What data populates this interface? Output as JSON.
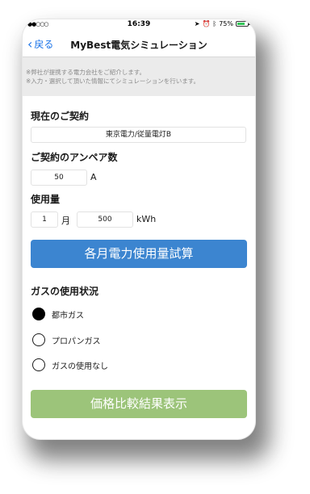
{
  "status_bar": {
    "time": "16:39",
    "signal": "●●○○○",
    "battery_percent": "75%",
    "battery_level": 0.75
  },
  "nav": {
    "back_label": "戻る",
    "title": "MyBest電気シミュレーション"
  },
  "notice": {
    "line1": "※弊社が提携する電力会社をご紹介します。",
    "line2": "※入力・選択して頂いた情報にてシミュレーションを行います。"
  },
  "contract": {
    "heading": "現在のご契約",
    "value": "東京電力/従量電灯B"
  },
  "ampere": {
    "heading": "ご契約のアンペア数",
    "value": "50",
    "unit": "A"
  },
  "usage": {
    "heading": "使用量",
    "month_value": "1",
    "month_unit": "月",
    "kwh_value": "500",
    "kwh_unit": "kWh"
  },
  "calc_button": {
    "label": "各月電力使用量試算"
  },
  "gas": {
    "heading": "ガスの使用状況",
    "options": [
      {
        "label": "都市ガス",
        "selected": true
      },
      {
        "label": "プロパンガス",
        "selected": false
      },
      {
        "label": "ガスの使用なし",
        "selected": false
      }
    ]
  },
  "compare_button": {
    "label": "価格比較結果表示"
  },
  "colors": {
    "accent_blue": "#3c85d0",
    "accent_green": "#9cc47a",
    "link_blue": "#1a73e8"
  }
}
